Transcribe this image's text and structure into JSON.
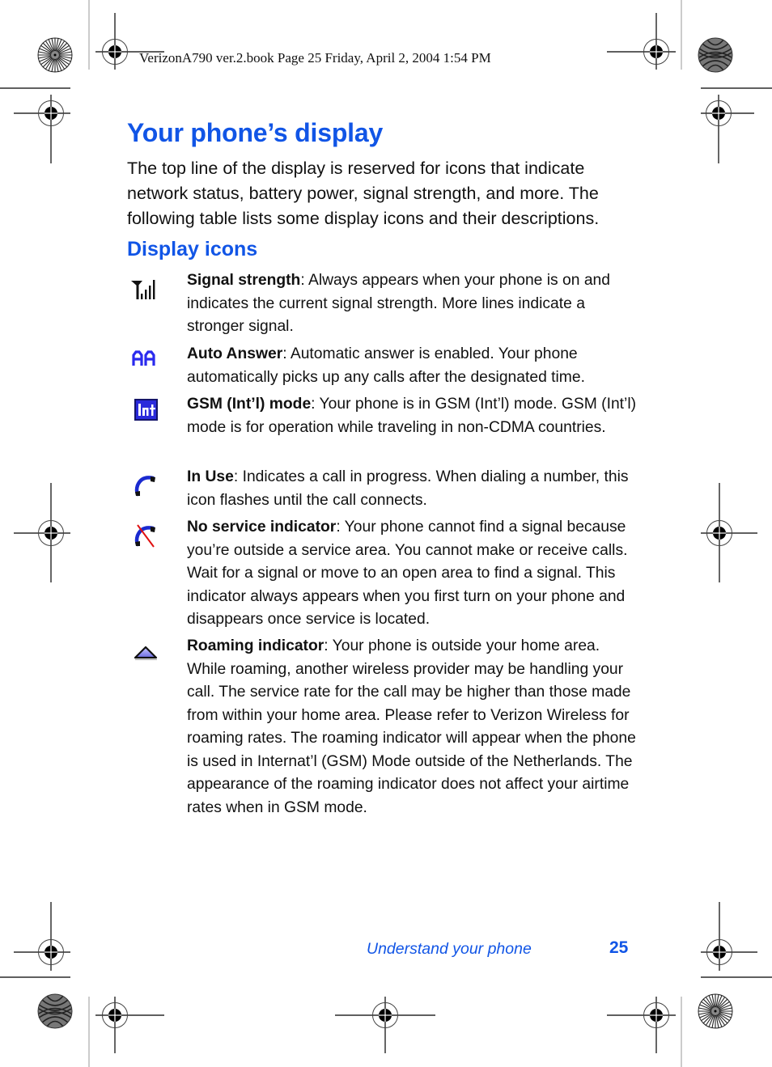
{
  "print_header": {
    "text": "VerizonA790 ver.2.book  Page 25  Friday, April 2, 2004  1:54 PM"
  },
  "page": {
    "title": "Your phone’s display",
    "intro": "The top line of the display is reserved for icons that indicate network status, battery power, signal strength, and more. The following table lists some display icons and their descriptions.",
    "section_title": "Display icons"
  },
  "icons": [
    {
      "icon": "signal-strength-icon",
      "term": "Signal strength",
      "description": ": Always appears when your phone is on and indicates the current signal strength. More lines indicate a stronger signal."
    },
    {
      "icon": "auto-answer-icon",
      "icon_text": "AA",
      "term": "Auto Answer",
      "description": ": Automatic answer is enabled. Your phone automatically picks up any calls after the designated time."
    },
    {
      "icon": "gsm-intl-mode-icon",
      "icon_text": "Int",
      "term": "GSM (Int’l) mode",
      "description": ": Your phone is in GSM (Int’l) mode. GSM (Int’l) mode is for operation while traveling in non-CDMA countries."
    },
    {
      "icon": "in-use-phone-icon",
      "term": "In Use",
      "description": ": Indicates a call in progress. When dialing a number, this icon flashes until the call connects."
    },
    {
      "icon": "no-service-icon",
      "term": "No service indicator",
      "description": ": Your phone cannot find a signal because you’re outside a service area. You cannot make or receive calls. Wait for a signal or move to an open area to find a signal. This indicator always appears when you first turn on your phone and disappears once service is located."
    },
    {
      "icon": "roaming-triangle-icon",
      "term": "Roaming indicator",
      "description": ": Your phone is outside your home area. While roaming, another wireless provider may be handling your call. The service rate for the call may be higher than those made from within your home area. Please refer to Verizon Wireless for roaming rates. The roaming indicator will appear when the phone is used in Internat’l (GSM) Mode outside of the Netherlands. The appearance of the roaming indicator does not affect your airtime rates when in GSM mode."
    }
  ],
  "footer": {
    "section": "Understand your phone",
    "page_number": "25"
  },
  "colors": {
    "heading_blue": "#1155e6",
    "icon_blue": "#2a2aee",
    "icon_red": "#e01010"
  }
}
